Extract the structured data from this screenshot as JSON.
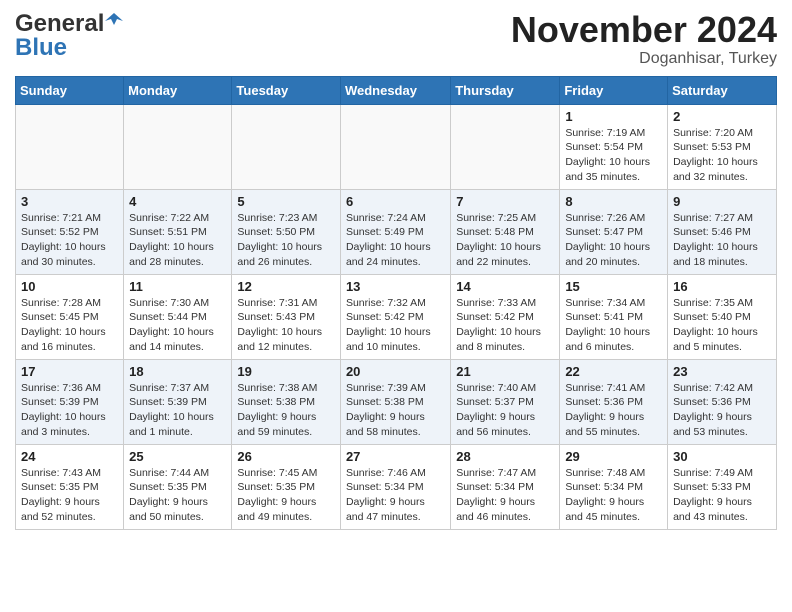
{
  "logo": {
    "line1": "General",
    "line2": "Blue"
  },
  "title": "November 2024",
  "subtitle": "Doganhisar, Turkey",
  "weekdays": [
    "Sunday",
    "Monday",
    "Tuesday",
    "Wednesday",
    "Thursday",
    "Friday",
    "Saturday"
  ],
  "weeks": [
    [
      {
        "day": "",
        "info": ""
      },
      {
        "day": "",
        "info": ""
      },
      {
        "day": "",
        "info": ""
      },
      {
        "day": "",
        "info": ""
      },
      {
        "day": "",
        "info": ""
      },
      {
        "day": "1",
        "info": "Sunrise: 7:19 AM\nSunset: 5:54 PM\nDaylight: 10 hours\nand 35 minutes."
      },
      {
        "day": "2",
        "info": "Sunrise: 7:20 AM\nSunset: 5:53 PM\nDaylight: 10 hours\nand 32 minutes."
      }
    ],
    [
      {
        "day": "3",
        "info": "Sunrise: 7:21 AM\nSunset: 5:52 PM\nDaylight: 10 hours\nand 30 minutes."
      },
      {
        "day": "4",
        "info": "Sunrise: 7:22 AM\nSunset: 5:51 PM\nDaylight: 10 hours\nand 28 minutes."
      },
      {
        "day": "5",
        "info": "Sunrise: 7:23 AM\nSunset: 5:50 PM\nDaylight: 10 hours\nand 26 minutes."
      },
      {
        "day": "6",
        "info": "Sunrise: 7:24 AM\nSunset: 5:49 PM\nDaylight: 10 hours\nand 24 minutes."
      },
      {
        "day": "7",
        "info": "Sunrise: 7:25 AM\nSunset: 5:48 PM\nDaylight: 10 hours\nand 22 minutes."
      },
      {
        "day": "8",
        "info": "Sunrise: 7:26 AM\nSunset: 5:47 PM\nDaylight: 10 hours\nand 20 minutes."
      },
      {
        "day": "9",
        "info": "Sunrise: 7:27 AM\nSunset: 5:46 PM\nDaylight: 10 hours\nand 18 minutes."
      }
    ],
    [
      {
        "day": "10",
        "info": "Sunrise: 7:28 AM\nSunset: 5:45 PM\nDaylight: 10 hours\nand 16 minutes."
      },
      {
        "day": "11",
        "info": "Sunrise: 7:30 AM\nSunset: 5:44 PM\nDaylight: 10 hours\nand 14 minutes."
      },
      {
        "day": "12",
        "info": "Sunrise: 7:31 AM\nSunset: 5:43 PM\nDaylight: 10 hours\nand 12 minutes."
      },
      {
        "day": "13",
        "info": "Sunrise: 7:32 AM\nSunset: 5:42 PM\nDaylight: 10 hours\nand 10 minutes."
      },
      {
        "day": "14",
        "info": "Sunrise: 7:33 AM\nSunset: 5:42 PM\nDaylight: 10 hours\nand 8 minutes."
      },
      {
        "day": "15",
        "info": "Sunrise: 7:34 AM\nSunset: 5:41 PM\nDaylight: 10 hours\nand 6 minutes."
      },
      {
        "day": "16",
        "info": "Sunrise: 7:35 AM\nSunset: 5:40 PM\nDaylight: 10 hours\nand 5 minutes."
      }
    ],
    [
      {
        "day": "17",
        "info": "Sunrise: 7:36 AM\nSunset: 5:39 PM\nDaylight: 10 hours\nand 3 minutes."
      },
      {
        "day": "18",
        "info": "Sunrise: 7:37 AM\nSunset: 5:39 PM\nDaylight: 10 hours\nand 1 minute."
      },
      {
        "day": "19",
        "info": "Sunrise: 7:38 AM\nSunset: 5:38 PM\nDaylight: 9 hours\nand 59 minutes."
      },
      {
        "day": "20",
        "info": "Sunrise: 7:39 AM\nSunset: 5:38 PM\nDaylight: 9 hours\nand 58 minutes."
      },
      {
        "day": "21",
        "info": "Sunrise: 7:40 AM\nSunset: 5:37 PM\nDaylight: 9 hours\nand 56 minutes."
      },
      {
        "day": "22",
        "info": "Sunrise: 7:41 AM\nSunset: 5:36 PM\nDaylight: 9 hours\nand 55 minutes."
      },
      {
        "day": "23",
        "info": "Sunrise: 7:42 AM\nSunset: 5:36 PM\nDaylight: 9 hours\nand 53 minutes."
      }
    ],
    [
      {
        "day": "24",
        "info": "Sunrise: 7:43 AM\nSunset: 5:35 PM\nDaylight: 9 hours\nand 52 minutes."
      },
      {
        "day": "25",
        "info": "Sunrise: 7:44 AM\nSunset: 5:35 PM\nDaylight: 9 hours\nand 50 minutes."
      },
      {
        "day": "26",
        "info": "Sunrise: 7:45 AM\nSunset: 5:35 PM\nDaylight: 9 hours\nand 49 minutes."
      },
      {
        "day": "27",
        "info": "Sunrise: 7:46 AM\nSunset: 5:34 PM\nDaylight: 9 hours\nand 47 minutes."
      },
      {
        "day": "28",
        "info": "Sunrise: 7:47 AM\nSunset: 5:34 PM\nDaylight: 9 hours\nand 46 minutes."
      },
      {
        "day": "29",
        "info": "Sunrise: 7:48 AM\nSunset: 5:34 PM\nDaylight: 9 hours\nand 45 minutes."
      },
      {
        "day": "30",
        "info": "Sunrise: 7:49 AM\nSunset: 5:33 PM\nDaylight: 9 hours\nand 43 minutes."
      }
    ]
  ]
}
